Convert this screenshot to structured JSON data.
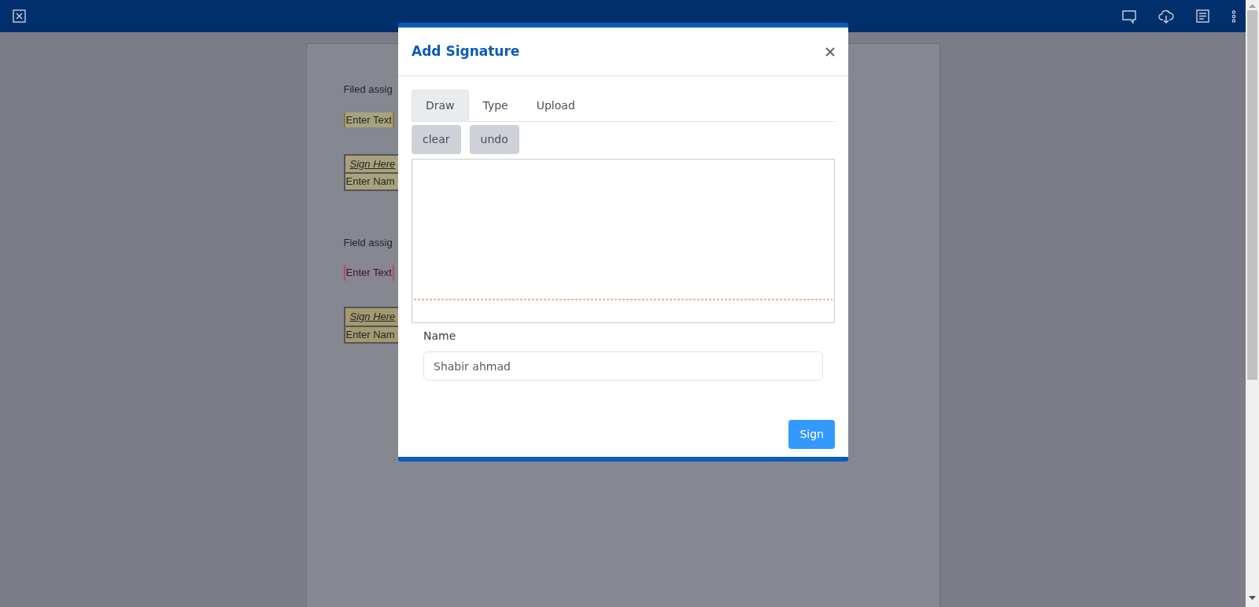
{
  "document": {
    "sections": [
      {
        "heading": "Filed assig",
        "fields": [
          {
            "kind": "text",
            "label": "Enter Text",
            "color": "#a8a37c"
          },
          {
            "kind": "signature",
            "sign_label": "Sign Here",
            "name_label": "Enter Nam",
            "color": "#a8a37c"
          }
        ]
      },
      {
        "heading": "Field assig",
        "fields": [
          {
            "kind": "text",
            "label": "Enter Text",
            "color": "#8f8293"
          },
          {
            "kind": "signature",
            "sign_label": "Sign Here",
            "name_label": "Enter Nam",
            "color": "#a39a70"
          }
        ]
      }
    ]
  },
  "modal": {
    "title": "Add Signature",
    "tabs": [
      {
        "label": "Draw",
        "selected": true
      },
      {
        "label": "Type",
        "selected": false
      },
      {
        "label": "Upload",
        "selected": false
      }
    ],
    "actions": [
      "clear",
      "undo"
    ],
    "name_field": {
      "label": "Name",
      "placeholder": "Shabir ahmad"
    },
    "submit": "Sign"
  }
}
